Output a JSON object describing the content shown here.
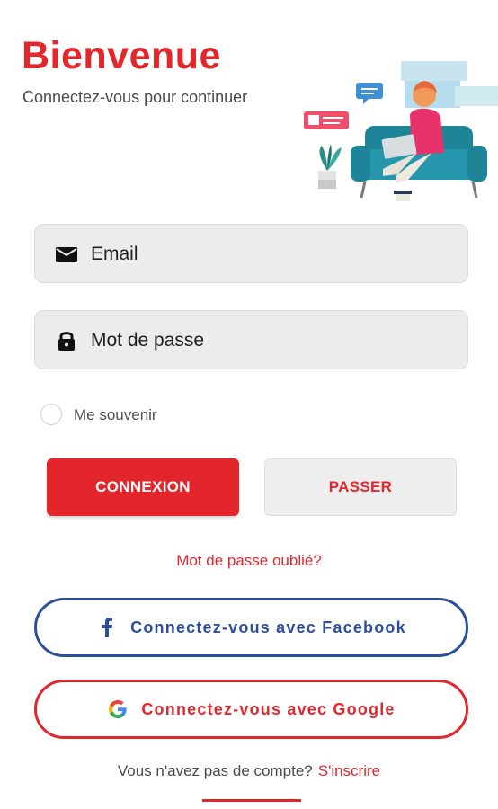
{
  "header": {
    "title": "Bienvenue",
    "subtitle": "Connectez-vous pour continuer"
  },
  "form": {
    "email": {
      "placeholder": "Email",
      "value": "",
      "icon": "mail-icon"
    },
    "password": {
      "placeholder": "Mot de passe",
      "value": "",
      "icon": "lock-icon"
    },
    "remember_label": "Me souvenir",
    "remember_checked": false
  },
  "buttons": {
    "login_label": "CONNEXION",
    "skip_label": "PASSER"
  },
  "forgot_password": "Mot de passe oublié?",
  "social": {
    "facebook_label": "Connectez-vous avec Facebook",
    "google_label": "Connectez-vous avec Google"
  },
  "signup": {
    "prompt": "Vous n'avez pas de compte?",
    "link": "S'inscrire"
  },
  "colors": {
    "primary": "#e3262c",
    "facebook": "#2d4f9a",
    "field_bg": "#ececec"
  }
}
